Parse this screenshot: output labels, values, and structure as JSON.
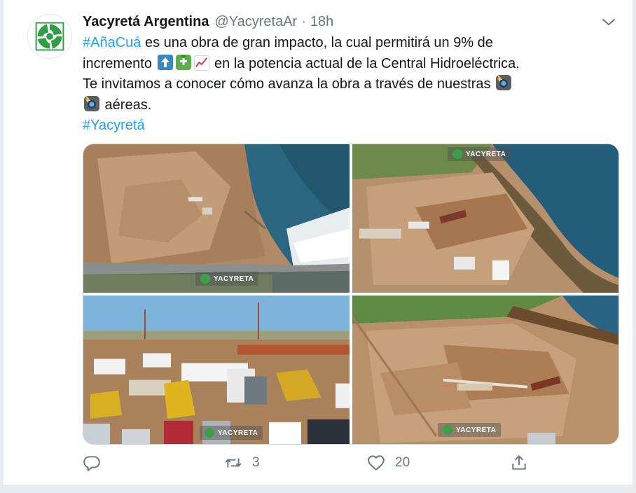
{
  "tweet": {
    "author_name": "Yacyretá Argentina",
    "handle": "@YacyretaAr",
    "separator": "·",
    "time": "18h",
    "line1_hashtag": "#AñaCuá",
    "line1_text": " es una obra de gran impacto, la cual permitirá un 9% de",
    "line2_text_a": "incremento ",
    "line2_text_b": " en la potencia actual de la Central Hidroeléctrica.",
    "line3_text": "Te invitamos a conocer cómo avanza la obra a través de nuestras ",
    "line4_text": " aéreas.",
    "line5_hashtag": "#Yacyretá",
    "emojis": [
      "up-arrow-emoji",
      "battery-emoji",
      "chart-increasing-emoji",
      "camera-flash-emoji",
      "camera-flash-emoji"
    ]
  },
  "media": {
    "watermark_text": "YACYRETA",
    "photos": [
      {
        "name": "aerial-dam-spillway-photo"
      },
      {
        "name": "aerial-construction-coast-photo"
      },
      {
        "name": "ground-construction-equipment-photo"
      },
      {
        "name": "aerial-earthworks-photo"
      }
    ]
  },
  "actions": {
    "reply_count": "",
    "retweet_count": "3",
    "like_count": "20",
    "share_count": ""
  },
  "colors": {
    "accent": "#1da1f2",
    "text": "#14171a",
    "muted": "#657786",
    "logo_green": "#3ca04a"
  }
}
